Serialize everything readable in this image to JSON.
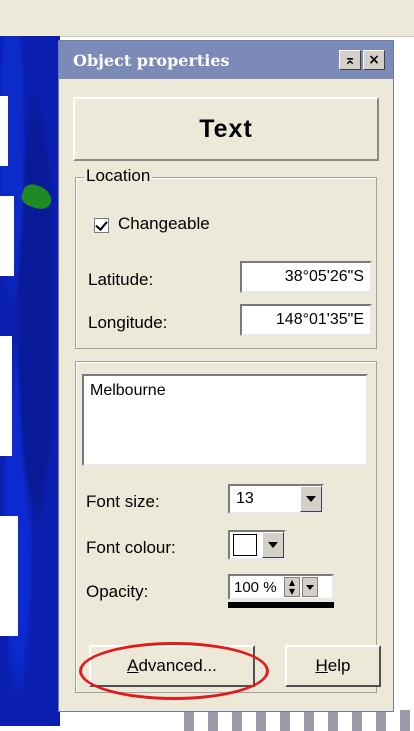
{
  "window": {
    "title": "Object properties",
    "restore_glyph": "⌅",
    "close_glyph": "×"
  },
  "header": {
    "label": "Text"
  },
  "location": {
    "legend": "Location",
    "changeable_label": "Changeable",
    "changeable_checked": true,
    "latitude_label": "Latitude:",
    "latitude_value": "38°05'26\"S",
    "longitude_label": "Longitude:",
    "longitude_value": "148°01'35\"E"
  },
  "text_group": {
    "text_value": "Melbourne",
    "font_size_label": "Font size:",
    "font_size_value": "13",
    "font_colour_label": "Font colour:",
    "font_colour_value": "#ffffff",
    "opacity_label": "Opacity:",
    "opacity_value": "100 %",
    "opacity_percent": 100
  },
  "buttons": {
    "advanced_first": "A",
    "advanced_rest": "dvanced...",
    "help_first": "H",
    "help_rest": "elp"
  },
  "colors": {
    "titlebar": "#7c8ab8",
    "panel_bg": "#ece9d8",
    "map_water": "#0a1fb0",
    "highlight_circle": "#e41a1a"
  }
}
